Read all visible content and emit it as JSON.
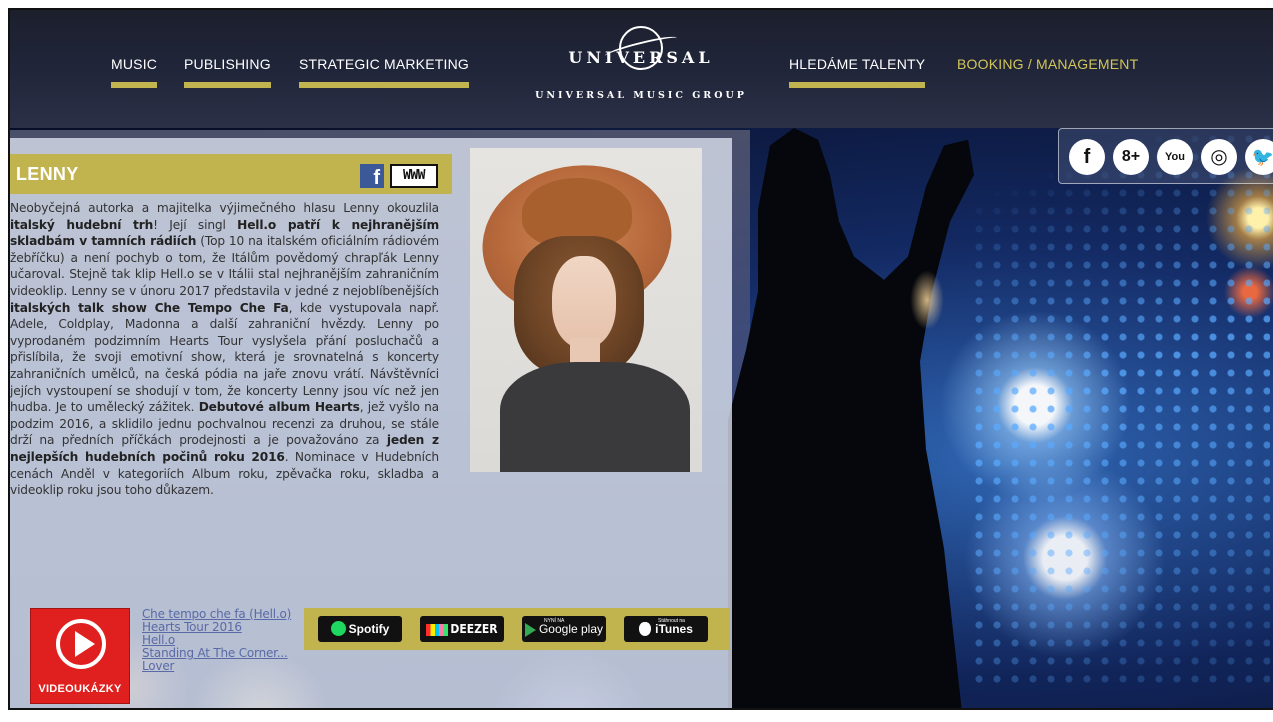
{
  "nav": {
    "left": [
      {
        "label": "MUSIC"
      },
      {
        "label": "PUBLISHING"
      },
      {
        "label": "STRATEGIC MARKETING"
      }
    ],
    "right": [
      {
        "label": "HLEDÁME TALENTY"
      },
      {
        "label": "BOOKING / MANAGEMENT"
      }
    ]
  },
  "logo": {
    "text": "UNIVERSAL",
    "subtitle": "UNIVERSAL MUSIC GROUP"
  },
  "social": [
    {
      "icon": "facebook-icon",
      "glyph": "f"
    },
    {
      "icon": "google-plus-icon",
      "glyph": "8+"
    },
    {
      "icon": "youtube-icon",
      "glyph": "You"
    },
    {
      "icon": "instagram-icon",
      "glyph": "◎"
    },
    {
      "icon": "twitter-icon",
      "glyph": "🐦"
    }
  ],
  "artist": {
    "name": "LENNY",
    "facebook_glyph": "f",
    "www_label": "WWW",
    "bio": [
      {
        "t": "Neobyčejná autorka a majitelka výjimečného hlasu Lenny okouzlila ",
        "b": false
      },
      {
        "t": "italský hudební trh",
        "b": true
      },
      {
        "t": "! Její singl ",
        "b": false
      },
      {
        "t": "Hell.o patří k nejhranějším skladbám v tamních rádiích",
        "b": true
      },
      {
        "t": " (Top 10 na italském oficiálním rádiovém žebříčku) a není pochyb o tom, že Itálům povědomý chrapľák Lenny učaroval. Stejně tak klip Hell.o se v Itálii stal nejhranějším zahraničním videoklip. Lenny se v únoru 2017 představila v jedné z nejoblíbenějších ",
        "b": false
      },
      {
        "t": "italských talk show Che Tempo Che Fa",
        "b": true
      },
      {
        "t": ", kde vystupovala např. Adele, Coldplay, Madonna a další zahraniční hvězdy. Lenny po vyprodaném podzimním Hearts Tour vyslyšela přání posluchačů a přislíbila, že svoji emotivní show, která je srovnatelná s koncerty zahraničních umělců, na česká pódia na jaře znovu vrátí. Návštěvníci jejích vystoupení se shodují v tom, že koncerty Lenny jsou víc než jen hudba. Je to umělecký zážitek. ",
        "b": false
      },
      {
        "t": "Debutové album Hearts",
        "b": true
      },
      {
        "t": ", jež vyšlo na podzim 2016, a sklidilo jednu pochvalnou recenzi za druhou, se stále drží na předních příčkách prodejnosti a je považováno za ",
        "b": false
      },
      {
        "t": "jeden z nejlepších hudebních počinů roku 2016",
        "b": true
      },
      {
        "t": ". Nominace v Hudebních cenách Anděl v kategoriích Album roku, zpěvačka roku, skladba a videoklip roku jsou toho důkazem.",
        "b": false
      }
    ]
  },
  "videos": {
    "label": "VIDEOUKÁZKY",
    "links": [
      "Che tempo che fa (Hell.o)",
      "Hearts Tour 2016",
      "Hell.o",
      "Standing At The Corner...",
      "Lover"
    ]
  },
  "streaming": {
    "spotify": "Spotify",
    "deezer": "DEEZER",
    "googleplay_small": "NYNÍ NA",
    "googleplay": "Google play",
    "itunes_small": "Stáhnout na",
    "itunes": "iTunes"
  },
  "colors": {
    "accent_gold": "#c1b44f",
    "video_red": "#e0201e",
    "facebook_blue": "#3b5998"
  }
}
